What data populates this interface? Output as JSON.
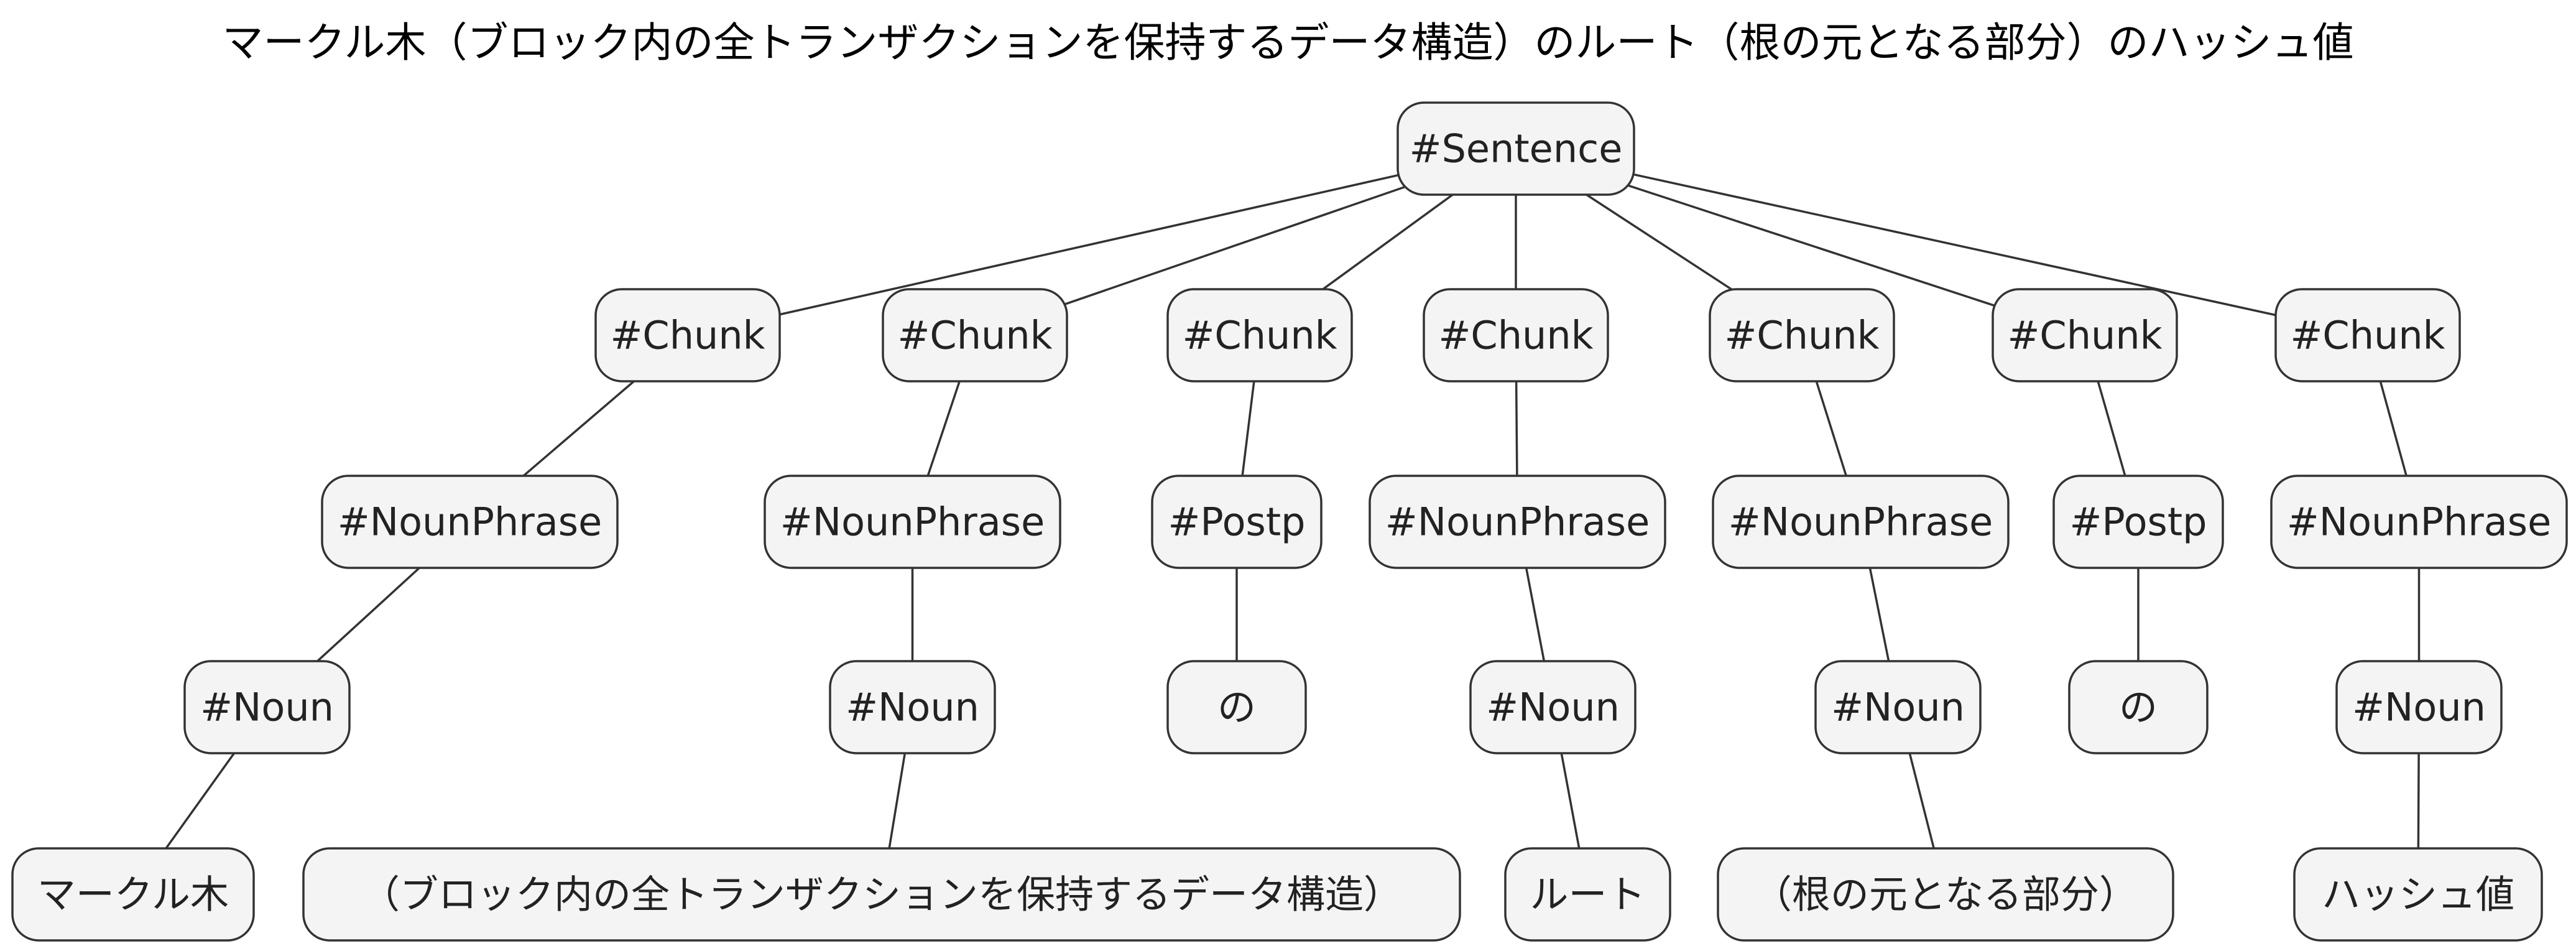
{
  "title": "マークル木（ブロック内の全トランザクションを保持するデータ構造）のルート（根の元となる部分）のハッシュ値",
  "colors": {
    "node_fill": "#f4f4f4",
    "node_stroke": "#333333",
    "edge": "#333333",
    "text": "#222222"
  },
  "tree": {
    "nodes": [
      {
        "id": "sentence",
        "label": "#Sentence",
        "parent": null
      },
      {
        "id": "chunk1",
        "label": "#Chunk",
        "parent": "sentence"
      },
      {
        "id": "chunk2",
        "label": "#Chunk",
        "parent": "sentence"
      },
      {
        "id": "chunk3",
        "label": "#Chunk",
        "parent": "sentence"
      },
      {
        "id": "chunk4",
        "label": "#Chunk",
        "parent": "sentence"
      },
      {
        "id": "chunk5",
        "label": "#Chunk",
        "parent": "sentence"
      },
      {
        "id": "chunk6",
        "label": "#Chunk",
        "parent": "sentence"
      },
      {
        "id": "chunk7",
        "label": "#Chunk",
        "parent": "sentence"
      },
      {
        "id": "np1",
        "label": "#NounPhrase",
        "parent": "chunk1"
      },
      {
        "id": "np2",
        "label": "#NounPhrase",
        "parent": "chunk2"
      },
      {
        "id": "postp1",
        "label": "#Postp",
        "parent": "chunk3"
      },
      {
        "id": "np3",
        "label": "#NounPhrase",
        "parent": "chunk4"
      },
      {
        "id": "np4",
        "label": "#NounPhrase",
        "parent": "chunk5"
      },
      {
        "id": "postp2",
        "label": "#Postp",
        "parent": "chunk6"
      },
      {
        "id": "np5",
        "label": "#NounPhrase",
        "parent": "chunk7"
      },
      {
        "id": "noun1",
        "label": "#Noun",
        "parent": "np1"
      },
      {
        "id": "noun2",
        "label": "#Noun",
        "parent": "np2"
      },
      {
        "id": "no1",
        "label": "の",
        "parent": "postp1"
      },
      {
        "id": "noun3",
        "label": "#Noun",
        "parent": "np3"
      },
      {
        "id": "noun4",
        "label": "#Noun",
        "parent": "np4"
      },
      {
        "id": "no2",
        "label": "の",
        "parent": "postp2"
      },
      {
        "id": "noun5",
        "label": "#Noun",
        "parent": "np5"
      },
      {
        "id": "word1",
        "label": "マークル木",
        "parent": "noun1"
      },
      {
        "id": "word2",
        "label": "（ブロック内の全トランザクションを保持するデータ構造）",
        "parent": "noun2"
      },
      {
        "id": "word3",
        "label": "ルート",
        "parent": "noun3"
      },
      {
        "id": "word4",
        "label": "（根の元となる部分）",
        "parent": "noun4"
      },
      {
        "id": "word5",
        "label": "ハッシュ値",
        "parent": "noun5"
      }
    ]
  }
}
